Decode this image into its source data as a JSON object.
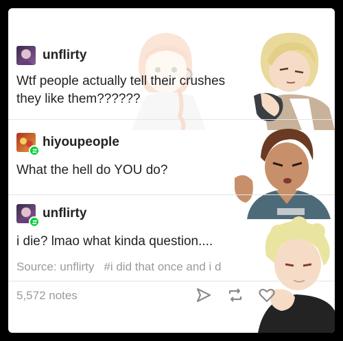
{
  "posts": [
    {
      "username": "unflirty",
      "text": [
        "Wtf people actually tell their crushes",
        "they like them??????"
      ]
    },
    {
      "username": "hiyoupeople",
      "text": [
        "What the hell do YOU do?"
      ]
    },
    {
      "username": "unflirty",
      "text": [
        "i die? lmao what kinda question...."
      ]
    }
  ],
  "meta": {
    "source": "Source: unflirty",
    "tag": "#i did that once and i d"
  },
  "footer": {
    "notes": "5,572 notes"
  },
  "icons": [
    "share-icon",
    "reblog-icon",
    "like-icon"
  ],
  "colors": {
    "reblog_badge": "#00cf35",
    "meta_text": "#9a9a9a",
    "body_text": "#222222"
  }
}
